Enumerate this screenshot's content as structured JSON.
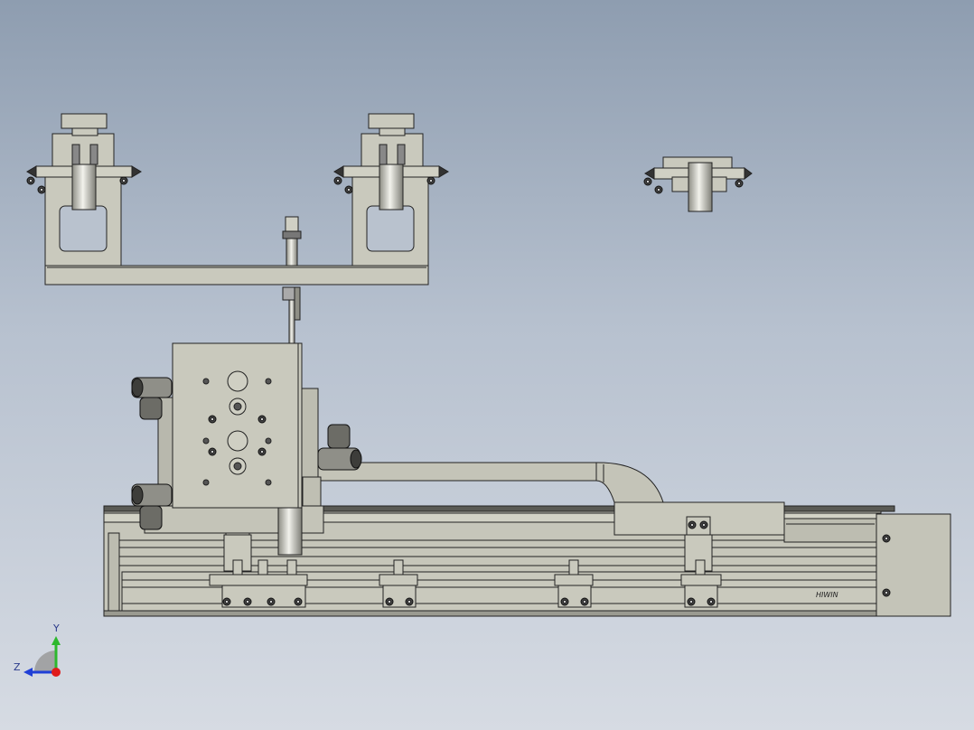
{
  "view": {
    "background_top": "#8e9db0",
    "background_bottom": "#d6dbe3",
    "part_fill": "#c9c9bd",
    "part_stroke": "#222222"
  },
  "rail": {
    "brand_label": "HIWIN"
  },
  "triad": {
    "y_label": "Y",
    "z_label": "Z",
    "y_color": "#2db82d",
    "z_color": "#1f3fd6",
    "x_color": "#e01b1b"
  }
}
